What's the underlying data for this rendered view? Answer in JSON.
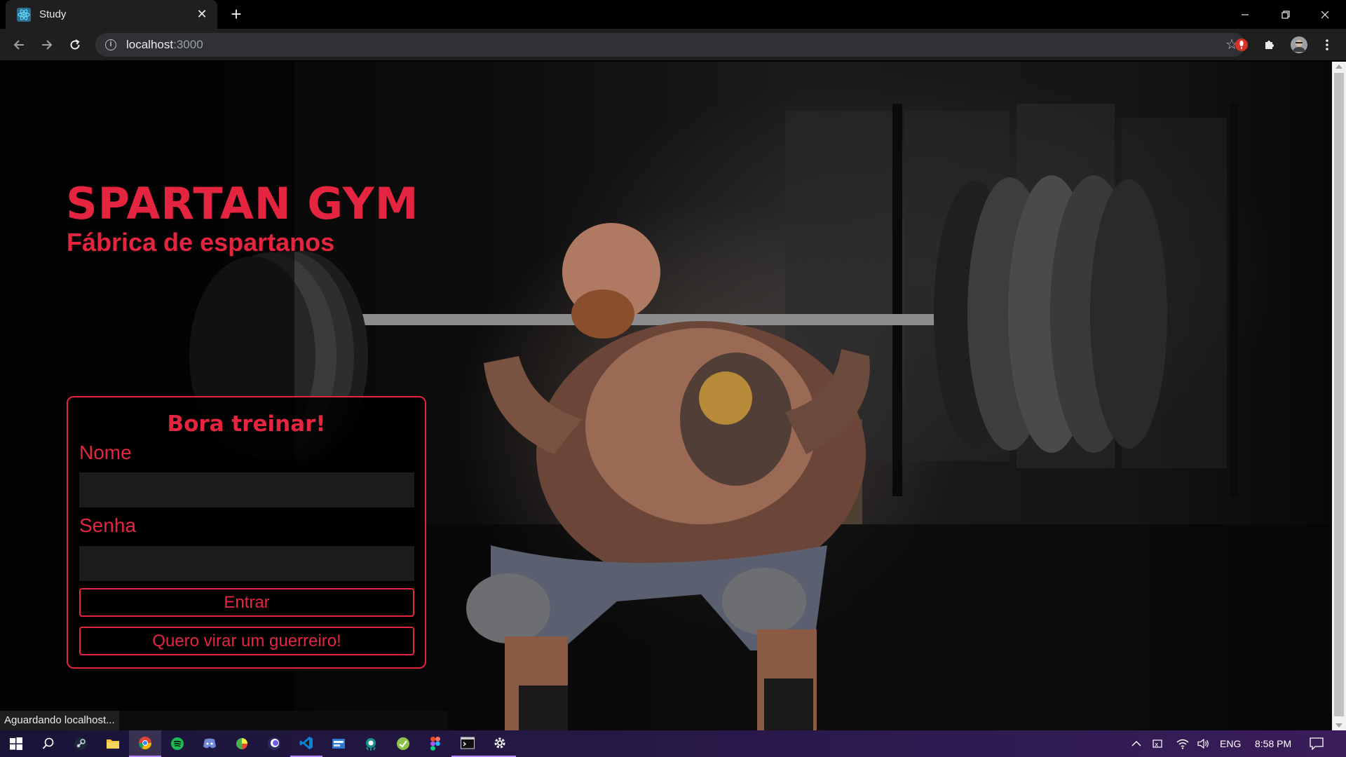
{
  "browser": {
    "tab": {
      "title": "Study",
      "favicon": "react-icon"
    },
    "address": {
      "host": "localhost",
      "port": ":3000"
    },
    "status_text": "Aguardando localhost..."
  },
  "hero": {
    "title": "SPARTAN GYM",
    "subtitle": "Fábrica de espartanos"
  },
  "login": {
    "title": "Bora treinar!",
    "name_label": "Nome",
    "name_value": "",
    "password_label": "Senha",
    "password_value": "",
    "submit_label": "Entrar",
    "register_label": "Quero virar um guerreiro!"
  },
  "taskbar": {
    "apps": [
      "start-icon",
      "search-icon",
      "steam-icon",
      "file-explorer-icon",
      "chrome-icon",
      "spotify-icon",
      "discord-icon",
      "app-icon",
      "browser-icon",
      "vscode-icon",
      "app-icon",
      "gitkraken-icon",
      "app-icon",
      "figma-icon",
      "terminal-icon",
      "settings-icon"
    ],
    "language": "ENG",
    "time": "8:58 PM"
  },
  "colors": {
    "accent": "#e5253f",
    "chrome_bg": "#1f1f1f"
  }
}
